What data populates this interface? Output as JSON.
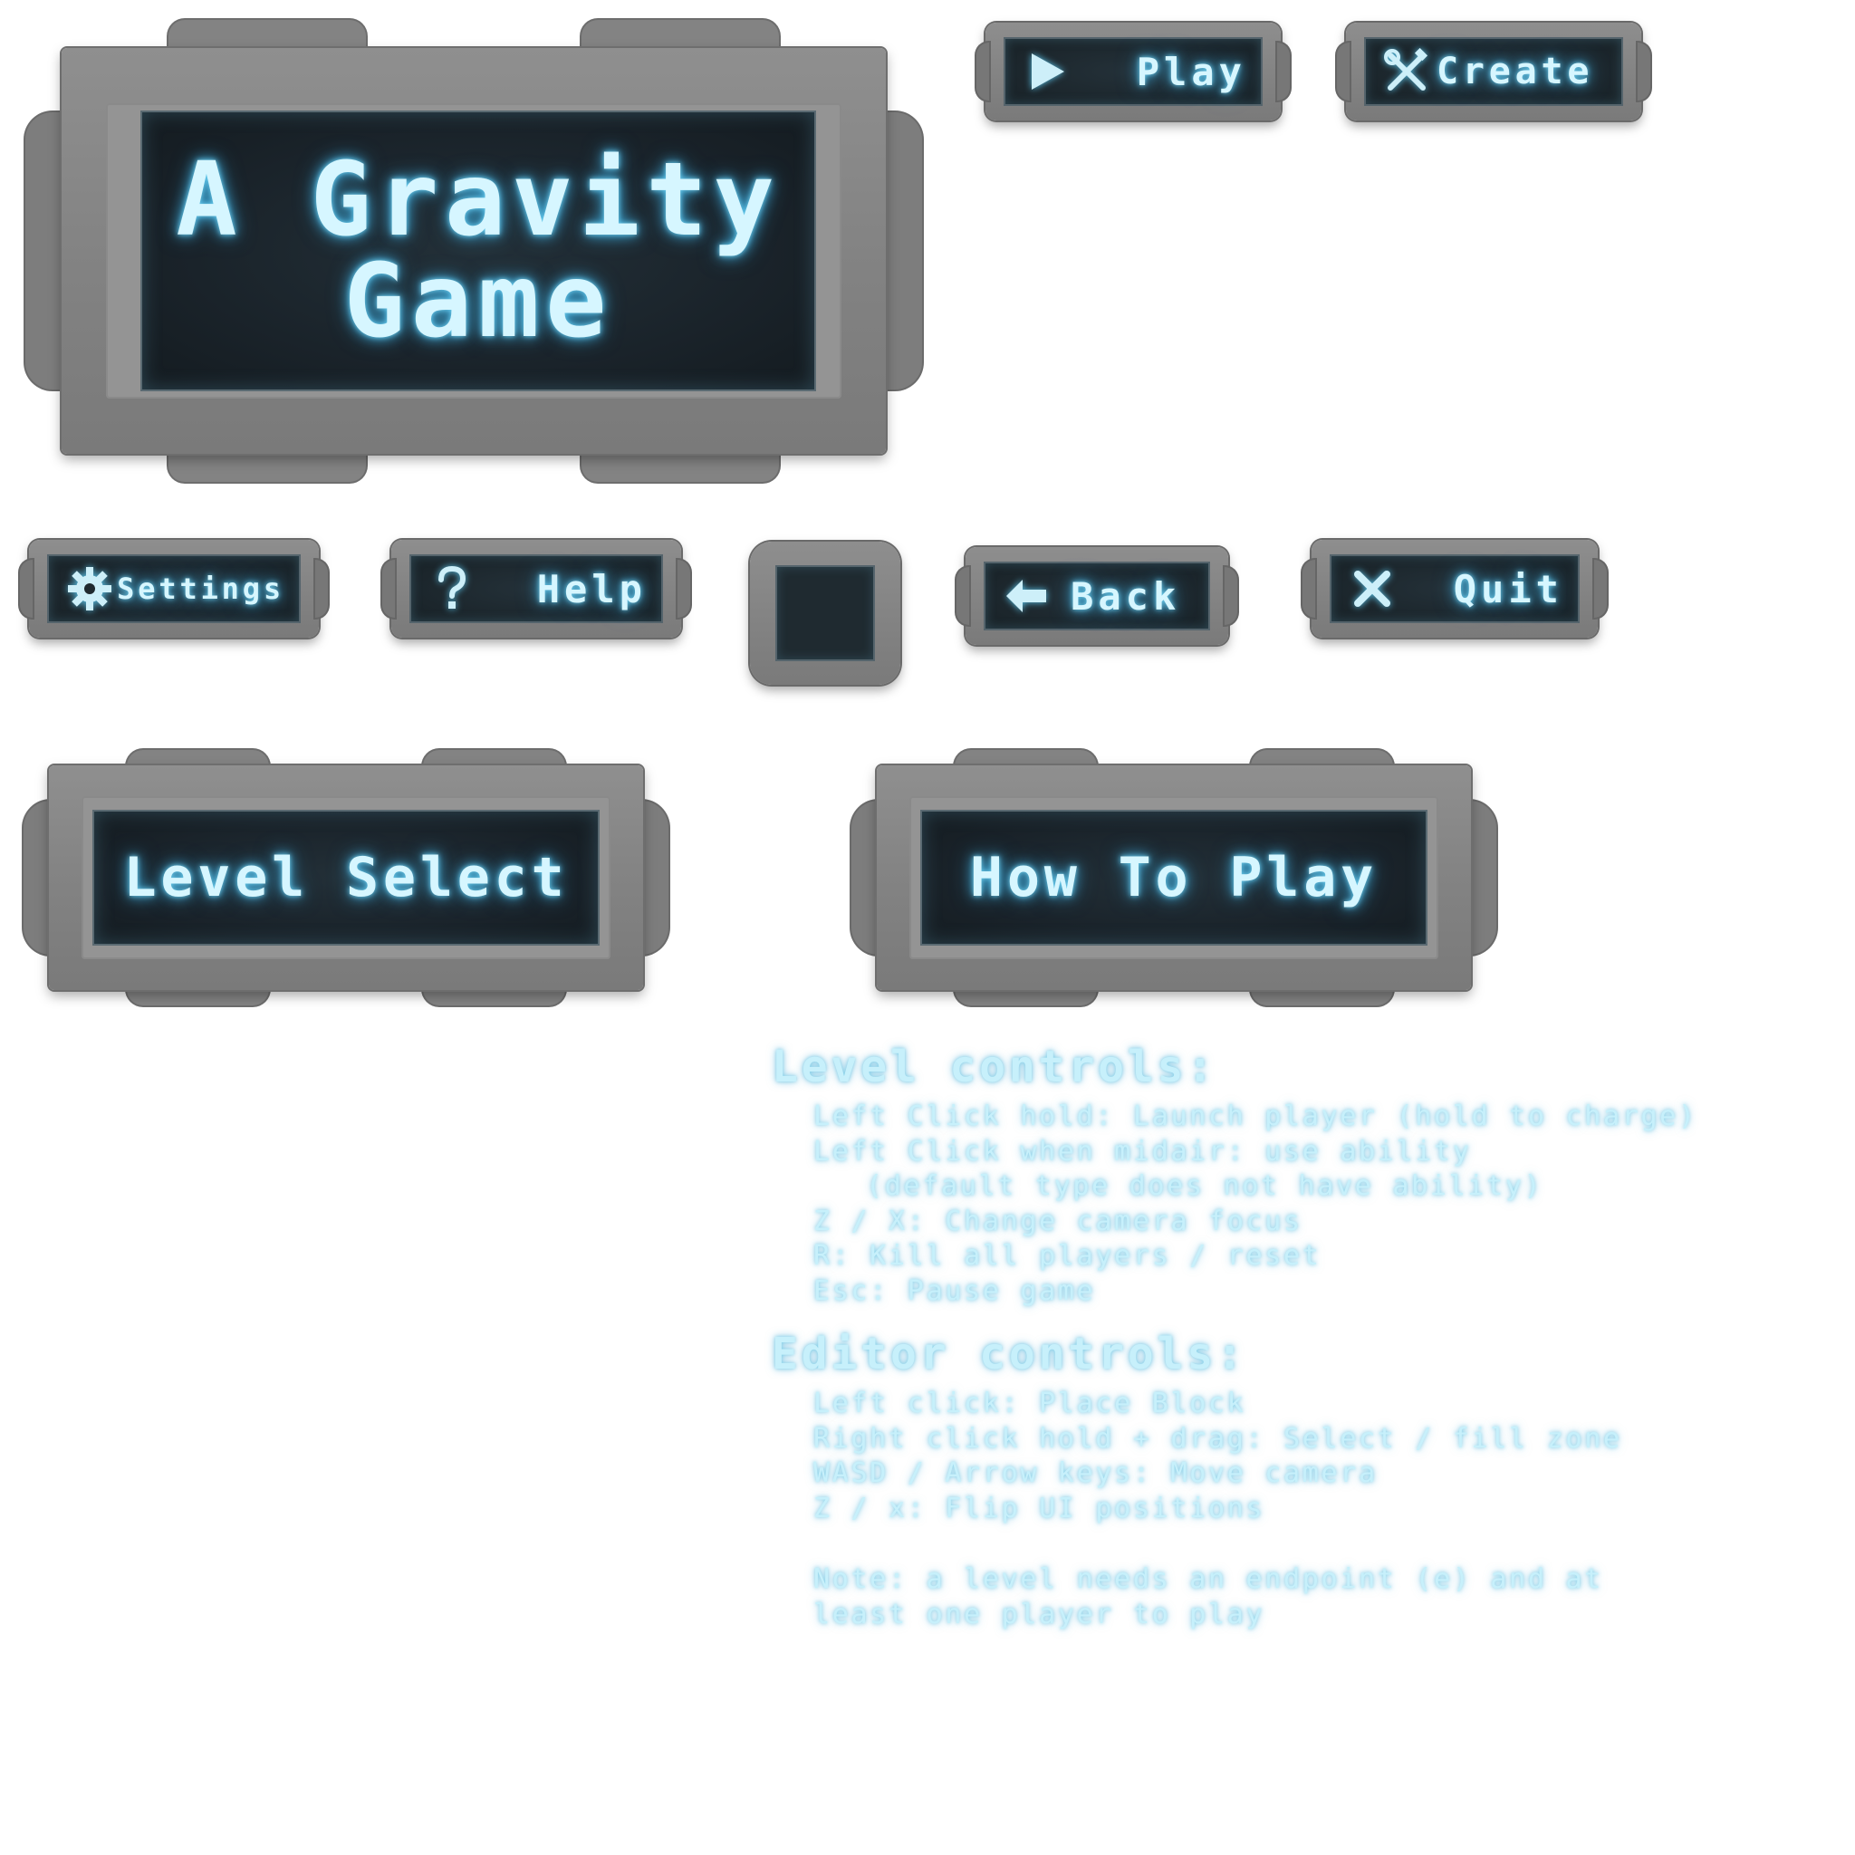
{
  "title": {
    "line1": "A Gravity",
    "line2": "Game"
  },
  "buttons": {
    "play": {
      "label": "Play",
      "icon": "play-icon"
    },
    "create": {
      "label": "Create",
      "icon": "tools-icon"
    },
    "settings": {
      "label": "Settings",
      "icon": "gear-icon"
    },
    "help": {
      "label": "Help",
      "icon": "question-icon"
    },
    "back": {
      "label": "Back",
      "icon": "arrow-left-icon"
    },
    "quit": {
      "label": "Quit",
      "icon": "close-icon"
    },
    "level_select": {
      "label": "Level Select"
    },
    "how_to_play": {
      "label": "How To Play"
    }
  },
  "controls": {
    "level_heading": "Level controls:",
    "level_lines": [
      "Left Click hold: Launch player (hold to charge)",
      "Left Click when midair: use ability",
      "(default type does not have ability)",
      "Z / X: Change camera focus",
      "R: Kill all players / reset",
      "Esc: Pause game"
    ],
    "editor_heading": "Editor controls:",
    "editor_lines": [
      "Left click: Place Block",
      "Right click hold + drag: Select / fill zone",
      "WASD / Arrow keys: Move camera",
      "Z / x: Flip UI positions"
    ],
    "note_lines": [
      "Note: a level needs an endpoint (e) and at",
      "least one player to play"
    ]
  },
  "colors": {
    "glow": "#6fd0f0",
    "text": "#d6f6ff",
    "panel": "#858585",
    "screen": "#1c252b"
  }
}
